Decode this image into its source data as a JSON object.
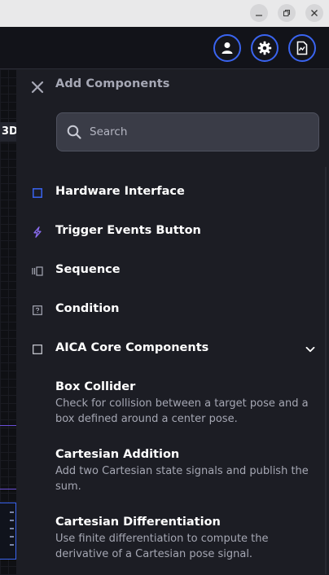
{
  "window_controls": {
    "minimize_icon": "minimize-icon",
    "restore_icon": "restore-icon",
    "close_icon": "close-icon"
  },
  "toolbar": {
    "buttons": [
      {
        "icon": "user-icon"
      },
      {
        "icon": "gear-icon"
      },
      {
        "icon": "document-chart-icon"
      }
    ],
    "accent_color": "#3a64f0"
  },
  "canvas": {
    "view_tab": "3D"
  },
  "panel": {
    "title": "Add Components",
    "search": {
      "placeholder": "Search",
      "value": ""
    },
    "categories": [
      {
        "label": "Hardware Interface",
        "icon": "hardware-square-icon",
        "color": "#3a64f0"
      },
      {
        "label": "Trigger Events Button",
        "icon": "lightning-icon",
        "color": "#8a6cf0"
      },
      {
        "label": "Sequence",
        "icon": "sequence-icon",
        "color": "#a6a8b5"
      },
      {
        "label": "Condition",
        "icon": "condition-question-icon",
        "color": "#a6a8b5"
      },
      {
        "label": "AICA Core Components",
        "icon": "square-outline-icon",
        "color": "#d0d2da",
        "expanded": true
      }
    ],
    "components": [
      {
        "name": "Box Collider",
        "description": "Check for collision between a target pose and a box defined around a center pose."
      },
      {
        "name": "Cartesian Addition",
        "description": "Add two Cartesian state signals and publish the sum."
      },
      {
        "name": "Cartesian Differentiation",
        "description": "Use finite differentiation to compute the derivative of a Cartesian pose signal."
      }
    ]
  }
}
